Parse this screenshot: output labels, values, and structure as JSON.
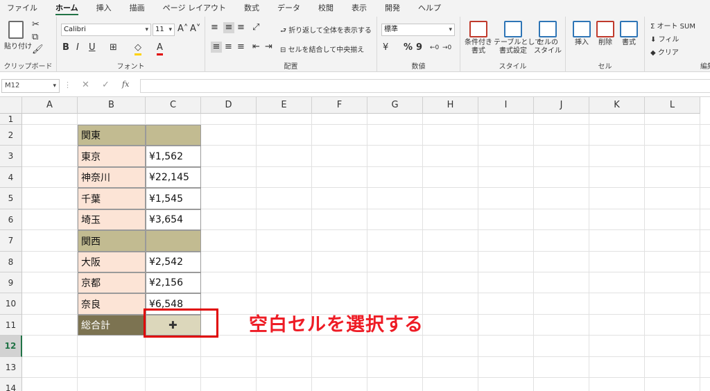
{
  "tabs": [
    "ファイル",
    "ホーム",
    "挿入",
    "描画",
    "ページ レイアウト",
    "数式",
    "データ",
    "校閲",
    "表示",
    "開発",
    "ヘルプ"
  ],
  "ribbon": {
    "clipboard": {
      "paste": "貼り付け",
      "label": "クリップボード"
    },
    "font": {
      "name": "Calibri",
      "size": "11",
      "bold": "B",
      "italic": "I",
      "underline": "U",
      "label": "フォント"
    },
    "alignment": {
      "wrap": "折り返して全体を表示する",
      "merge": "セルを結合して中央揃え",
      "label": "配置"
    },
    "number": {
      "format": "標準",
      "label": "数値"
    },
    "styles": {
      "conditional": "条件付き\n書式",
      "table": "テーブルとして\n書式設定",
      "cell": "セルの\nスタイル",
      "label": "スタイル"
    },
    "cells": {
      "insert": "挿入",
      "delete": "削除",
      "format": "書式",
      "label": "セル"
    },
    "editing": {
      "autosum": "オート SUM",
      "fill": "フィル",
      "clear": "クリア",
      "label": "編集"
    }
  },
  "formula_bar": {
    "name_box": "M12",
    "fx": "fx",
    "value": ""
  },
  "columns": [
    "A",
    "B",
    "C",
    "D",
    "E",
    "F",
    "G",
    "H",
    "I",
    "J",
    "K",
    "L"
  ],
  "rows": [
    "1",
    "2",
    "3",
    "4",
    "5",
    "6",
    "7",
    "8",
    "9",
    "10",
    "11",
    "12",
    "13",
    "14"
  ],
  "selected_row": "12",
  "cells": [
    {
      "row": 2,
      "col": "B",
      "text": "関東",
      "style": "olive"
    },
    {
      "row": 2,
      "col": "C",
      "text": "",
      "style": "olive"
    },
    {
      "row": 3,
      "col": "B",
      "text": "東京",
      "style": "peach"
    },
    {
      "row": 3,
      "col": "C",
      "text": "¥1,562",
      "style": "white"
    },
    {
      "row": 4,
      "col": "B",
      "text": "神奈川",
      "style": "peach"
    },
    {
      "row": 4,
      "col": "C",
      "text": "¥22,145",
      "style": "white"
    },
    {
      "row": 5,
      "col": "B",
      "text": "千葉",
      "style": "peach"
    },
    {
      "row": 5,
      "col": "C",
      "text": "¥1,545",
      "style": "white"
    },
    {
      "row": 6,
      "col": "B",
      "text": "埼玉",
      "style": "peach"
    },
    {
      "row": 6,
      "col": "C",
      "text": "¥3,654",
      "style": "white"
    },
    {
      "row": 7,
      "col": "B",
      "text": "関西",
      "style": "olive"
    },
    {
      "row": 7,
      "col": "C",
      "text": "",
      "style": "olive"
    },
    {
      "row": 8,
      "col": "B",
      "text": "大阪",
      "style": "peach"
    },
    {
      "row": 8,
      "col": "C",
      "text": "¥2,542",
      "style": "white"
    },
    {
      "row": 9,
      "col": "B",
      "text": "京都",
      "style": "peach"
    },
    {
      "row": 9,
      "col": "C",
      "text": "¥2,156",
      "style": "white"
    },
    {
      "row": 10,
      "col": "B",
      "text": "奈良",
      "style": "peach"
    },
    {
      "row": 10,
      "col": "C",
      "text": "¥6,548",
      "style": "white"
    },
    {
      "row": 11,
      "col": "B",
      "text": "総合計",
      "style": "dark"
    },
    {
      "row": 11,
      "col": "C",
      "text": "",
      "style": "selected"
    }
  ],
  "annotation": "空白セルを選択する",
  "colors": {
    "accent": "#217346",
    "annotation": "#ee1c25"
  }
}
